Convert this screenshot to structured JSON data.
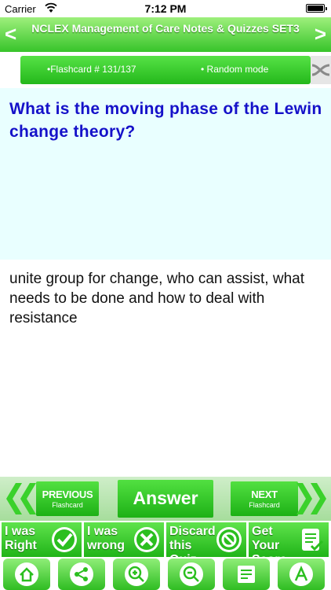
{
  "status": {
    "carrier": "Carrier",
    "time": "7:12 PM"
  },
  "nav": {
    "title": "NCLEX Management of Care Notes & Quizzes SET3",
    "back_label": "<",
    "forward_label": ">"
  },
  "info": {
    "counter": "•Flashcard # 131/137",
    "mode": "• Random mode"
  },
  "question": "What is the moving phase of the Lewin change theory?",
  "answer": "unite group for change, who can assist, what needs to be done and how to deal with resistance",
  "controls": {
    "previous_label": "PREVIOUS",
    "previous_sub": "Flashcard",
    "answer_label": "Answer",
    "next_label": "NEXT",
    "next_sub": "Flashcard"
  },
  "score_buttons": [
    {
      "label": "I was Right",
      "icon": "check-icon"
    },
    {
      "label": "I was wrong",
      "icon": "x-icon"
    },
    {
      "label": "Discard this Quiz",
      "icon": "no-entry-icon"
    },
    {
      "label": "Get Your Score",
      "icon": "score-list-icon"
    }
  ],
  "toolbar_icons": [
    "home-icon",
    "share-icon",
    "zoom-in-icon",
    "zoom-out-icon",
    "notes-icon",
    "font-icon"
  ],
  "colors": {
    "accent_green": "#2fbd22",
    "question_text": "#1511c9",
    "question_bg": "#e9ffff"
  }
}
